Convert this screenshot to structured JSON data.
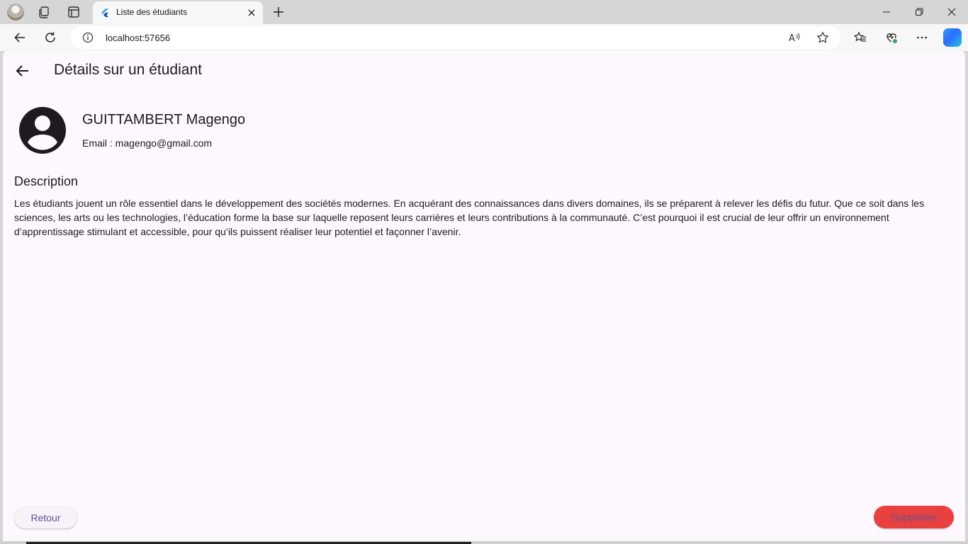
{
  "browser": {
    "tab_title": "Liste des étudiants",
    "address": "localhost:57656",
    "icons": {
      "profile": "profile-avatar-icon",
      "workspaces": "workspaces-icon",
      "tab_actions": "tab-actions-icon",
      "flutter_favicon": "flutter-favicon-icon",
      "close_tab": "close-icon",
      "new_tab": "plus-icon",
      "minimize": "minimize-icon",
      "restore": "restore-icon",
      "close_window": "close-icon",
      "back": "arrow-left-icon",
      "refresh": "refresh-icon",
      "site_info": "info-icon",
      "read_aloud": "read-aloud-icon",
      "favorite": "star-icon",
      "favorites": "favorites-icon",
      "browser_essentials": "heart-pulse-icon",
      "more": "more-icon",
      "copilot": "copilot-icon"
    }
  },
  "app": {
    "title": "Détails sur un étudiant",
    "student": {
      "name": "GUITTAMBERT Magengo",
      "email": "Email : magengo@gmail.com"
    },
    "description_title": "Description",
    "description": "Les étudiants jouent un rôle essentiel dans le développement des sociétés modernes. En acquérant des connaissances dans divers domaines, ils se préparent à relever les défis du futur. Que ce soit dans les sciences, les arts ou les technologies, l’éducation forme la base sur laquelle reposent leurs carrières et leurs contributions à la communauté. C’est pourquoi il est crucial de leur offrir un environnement d’apprentissage stimulant et accessible, pour qu’ils puissent réaliser leur potentiel et façonner l’avenir.",
    "buttons": {
      "back": "Retour",
      "delete": "Supprimer"
    },
    "colors": {
      "background": "#fdf7fe",
      "delete_button": "#e94040",
      "button_text": "#65558f"
    }
  }
}
